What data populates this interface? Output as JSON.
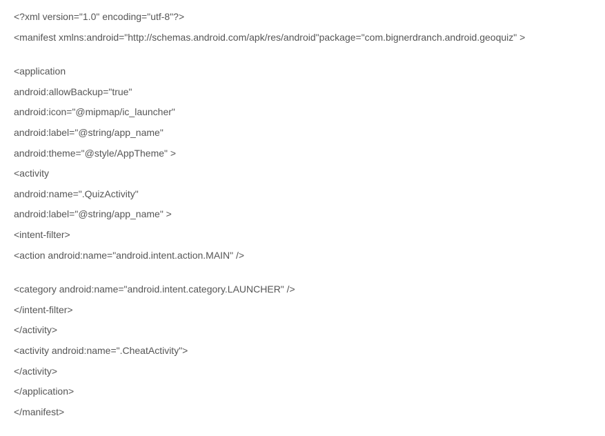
{
  "lines": [
    "<?xml version=\"1.0\" encoding=\"utf-8\"?>",
    "<manifest xmlns:android=\"http://schemas.android.com/apk/res/android\"package=\"com.bignerdranch.android.geoquiz\" >",
    "",
    "<application",
    "android:allowBackup=\"true\"",
    "android:icon=\"@mipmap/ic_launcher\"",
    "android:label=\"@string/app_name\"",
    "android:theme=\"@style/AppTheme\" >",
    "<activity",
    "android:name=\".QuizActivity\"",
    "android:label=\"@string/app_name\" >",
    "<intent-filter>",
    "<action android:name=\"android.intent.action.MAIN\" />",
    "",
    "<category android:name=\"android.intent.category.LAUNCHER\" />",
    "</intent-filter>",
    "</activity>",
    "<activity android:name=\".CheatActivity\">",
    "</activity>",
    "</application>",
    "</manifest>"
  ]
}
